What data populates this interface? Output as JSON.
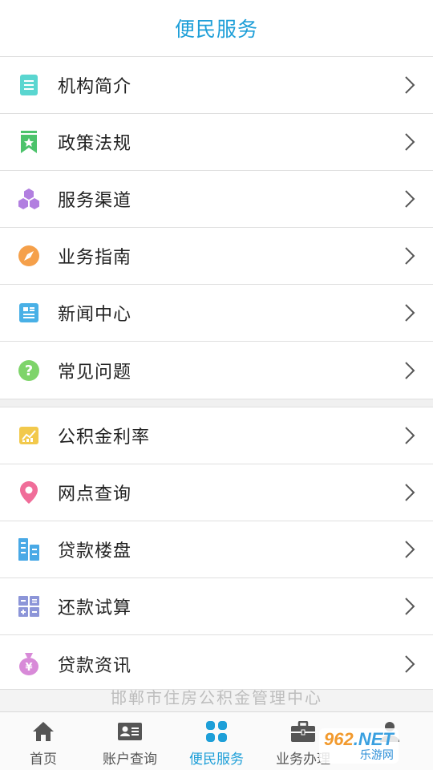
{
  "header": {
    "title": "便民服务"
  },
  "group1": [
    {
      "label": "机构简介",
      "icon": "document-list-icon",
      "color": "#5ad6d0"
    },
    {
      "label": "政策法规",
      "icon": "bookmark-star-icon",
      "color": "#4cc36b"
    },
    {
      "label": "服务渠道",
      "icon": "hexagons-icon",
      "color": "#b27fe0"
    },
    {
      "label": "业务指南",
      "icon": "compass-icon",
      "color": "#f5a04a"
    },
    {
      "label": "新闻中心",
      "icon": "newspaper-icon",
      "color": "#49b0e6"
    },
    {
      "label": "常见问题",
      "icon": "question-circle-icon",
      "color": "#7ed46a"
    }
  ],
  "group2": [
    {
      "label": "公积金利率",
      "icon": "rate-chart-icon",
      "color": "#f2c94c"
    },
    {
      "label": "网点查询",
      "icon": "location-pin-icon",
      "color": "#f06d99"
    },
    {
      "label": "贷款楼盘",
      "icon": "buildings-icon",
      "color": "#49a9e6"
    },
    {
      "label": "还款试算",
      "icon": "calculator-icon",
      "color": "#8c95d8"
    },
    {
      "label": "贷款资讯",
      "icon": "money-bag-icon",
      "color": "#d88ad8"
    }
  ],
  "footer": {
    "org_name": "邯郸市住房公积金管理中心"
  },
  "tabs": [
    {
      "label": "首页",
      "icon": "home-icon",
      "active": false
    },
    {
      "label": "账户查询",
      "icon": "id-card-icon",
      "active": false
    },
    {
      "label": "便民服务",
      "icon": "grid-icon",
      "active": true
    },
    {
      "label": "业务办理",
      "icon": "briefcase-icon",
      "active": false
    },
    {
      "label": "",
      "icon": "user-icon",
      "active": false
    }
  ],
  "watermark": {
    "brand": "962",
    "brand_suffix": ".NET",
    "site": "乐游网"
  },
  "colors": {
    "accent": "#1e9fd8",
    "tab_inactive": "#555555"
  }
}
